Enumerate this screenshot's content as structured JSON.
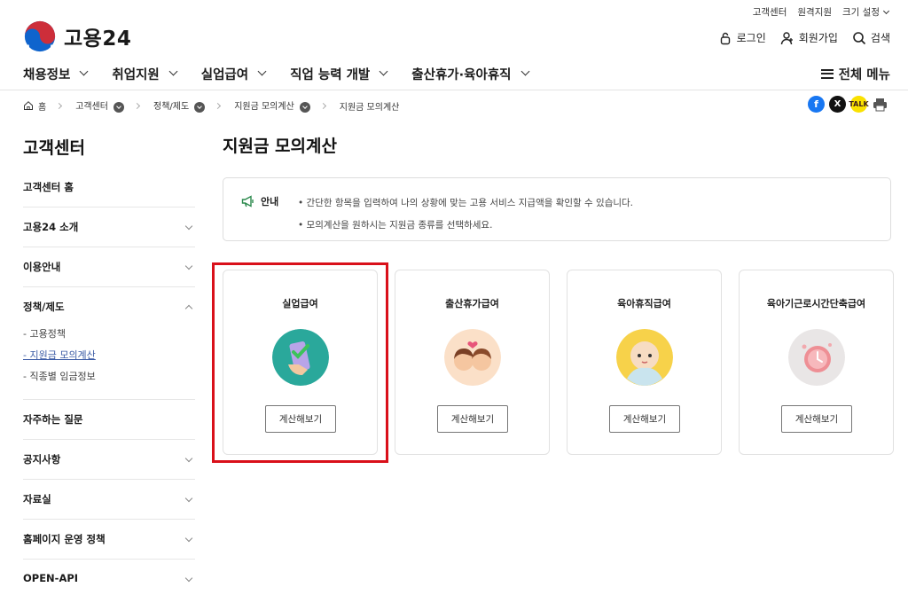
{
  "utility": {
    "customer_center": "고객센터",
    "remote_support": "원격지원",
    "font_size": "크기 설정"
  },
  "logo": {
    "text": "고용24"
  },
  "header_actions": {
    "login": "로그인",
    "signup": "회원가입",
    "search": "검색"
  },
  "gnb": {
    "items": [
      "채용정보",
      "취업지원",
      "실업급여",
      "직업 능력 개발",
      "출산휴가·육아휴직"
    ],
    "all_menu": "전체 메뉴"
  },
  "breadcrumb": {
    "home": "홈",
    "c1": "고객센터",
    "c2": "정책/제도",
    "c3": "지원금 모의계산",
    "c4": "지원금 모의계산"
  },
  "share": {
    "x": "X",
    "kakao": "TALK"
  },
  "lnb": {
    "title": "고객센터",
    "items": [
      "고객센터 홈",
      "고용24 소개",
      "이용안내",
      "정책/제도",
      "자주하는 질문",
      "공지사항",
      "자료실",
      "홈페이지 운영 정책",
      "OPEN-API"
    ],
    "sub": [
      "- 고용정책",
      "- 지원금 모의계산",
      "- 직종별 임금정보"
    ]
  },
  "content": {
    "title": "지원금 모의계산",
    "notice_label": "안내",
    "notice_lines": [
      "• 간단한 항목을 입력하여 나의 상황에 맞는 고용 서비스 지급액을 확인할 수 있습니다.",
      "• 모의계산을 원하시는 지원금 종류를 선택하세요."
    ],
    "cards": [
      {
        "name": "실업급여",
        "button": "계산해보기"
      },
      {
        "name": "출산휴가급여",
        "button": "계산해보기"
      },
      {
        "name": "육아휴직급여",
        "button": "계산해보기"
      },
      {
        "name": "육아기근로시간단축급여",
        "button": "계산해보기"
      }
    ]
  }
}
